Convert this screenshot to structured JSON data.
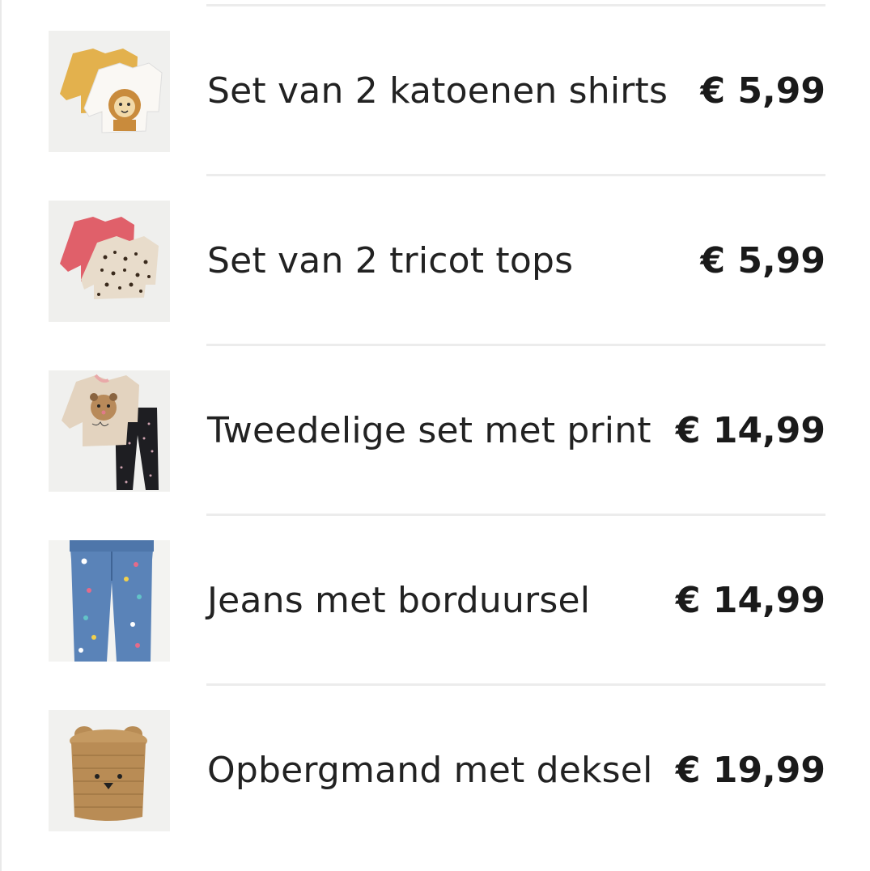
{
  "products": [
    {
      "name": "Set van 2 katoenen shirts",
      "price": "€ 5,99",
      "image": "two-cotton-shirts-lion-print-image"
    },
    {
      "name": "Set van 2 tricot tops",
      "price": "€ 5,99",
      "image": "two-jersey-tops-leopard-print-image"
    },
    {
      "name": "Tweedelige set met print",
      "price": "€ 14,99",
      "image": "two-piece-set-leopard-sweater-leggings-image"
    },
    {
      "name": "Jeans met borduursel",
      "price": "€ 14,99",
      "image": "embroidered-jeans-image"
    },
    {
      "name": "Opbergmand met deksel",
      "price": "€ 19,99",
      "image": "bear-storage-basket-image"
    }
  ]
}
